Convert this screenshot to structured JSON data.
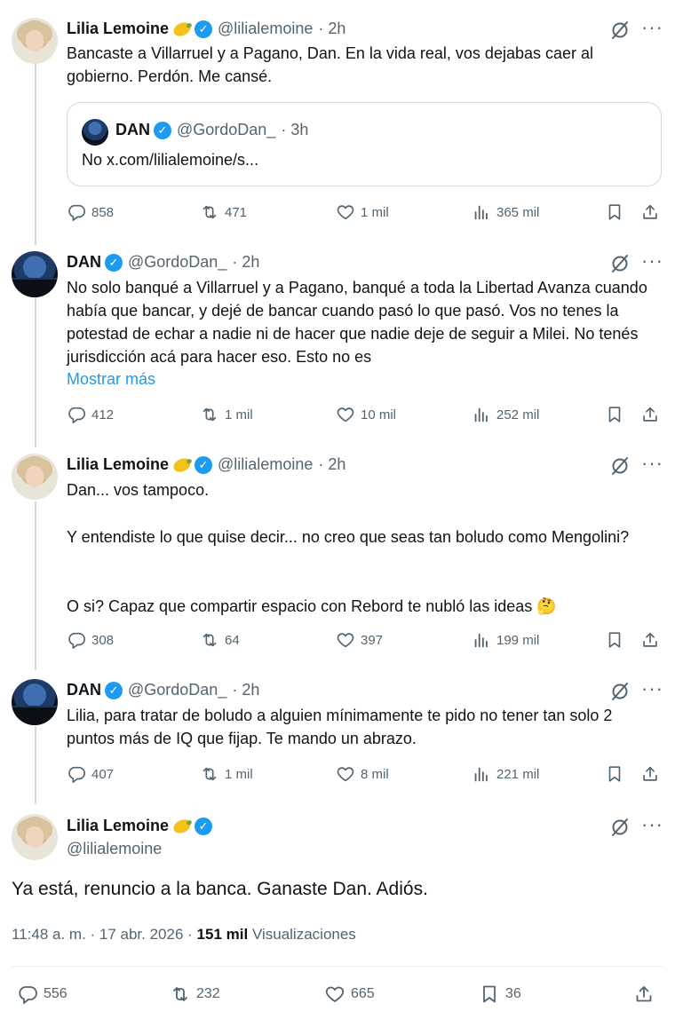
{
  "tweets": [
    {
      "name": "Lilia Lemoine",
      "handle": "@lilialemoine",
      "time": "· 2h",
      "text": "Bancaste a Villarruel y a Pagano, Dan. En la vida real, vos dejabas caer al gobierno. Perdón. Me cansé.",
      "quote": {
        "name": "DAN",
        "handle": "@GordoDan_",
        "time": "· 3h",
        "text": "No x.com/lilialemoine/s..."
      },
      "replies": "858",
      "reposts": "471",
      "likes": "1 mil",
      "views": "365 mil"
    },
    {
      "name": "DAN",
      "handle": "@GordoDan_",
      "time": "· 2h",
      "text": "No solo banqué a Villarruel y a Pagano, banqué a toda la Libertad Avanza cuando había que bancar, y dejé de bancar cuando pasó lo que pasó. Vos no tenes la potestad de echar a nadie ni de hacer que nadie deje de seguir a Milei. No tenés jurisdicción acá para hacer eso. Esto no es",
      "show_more": "Mostrar más",
      "replies": "412",
      "reposts": "1 mil",
      "likes": "10 mil",
      "views": "252 mil"
    },
    {
      "name": "Lilia Lemoine",
      "handle": "@lilialemoine",
      "time": "· 2h",
      "text_lines": [
        "Dan... vos tampoco.",
        "Y entendiste lo que quise decir... no creo que seas tan boludo como Mengolini?",
        "O si? Capaz que compartir espacio con Rebord te nubló las ideas 🤔"
      ],
      "replies": "308",
      "reposts": "64",
      "likes": "397",
      "views": "199 mil"
    },
    {
      "name": "DAN",
      "handle": "@GordoDan_",
      "time": "· 2h",
      "text": "Lilia, para tratar de boludo a alguien mínimamente te pido no tener tan solo 2 puntos más de IQ que fijap. Te mando un abrazo.",
      "replies": "407",
      "reposts": "1 mil",
      "likes": "8 mil",
      "views": "221 mil"
    }
  ],
  "main": {
    "name": "Lilia Lemoine",
    "handle": "@lilialemoine",
    "text": "Ya está, renuncio a la banca. Ganaste Dan. Adiós.",
    "timestamp": "11:48 a. m. · 17 abr. 2026 · ",
    "views_count": "151 mil",
    "views_label": "Visualizaciones",
    "replies": "556",
    "reposts": "232",
    "likes": "665",
    "bookmarks": "36"
  },
  "icons": {
    "verified": "verified-badge-icon",
    "lemon": "lemon-emoji-icon",
    "grok": "grok-icon",
    "more": "more-icon",
    "reply": "reply-icon",
    "repost": "repost-icon",
    "like": "heart-icon",
    "views": "views-bar-icon",
    "bookmark": "bookmark-icon",
    "share": "share-icon"
  },
  "colors": {
    "accent": "#1d9bf0",
    "muted": "#536471",
    "text": "#0f1419",
    "border": "#cfd9de"
  }
}
